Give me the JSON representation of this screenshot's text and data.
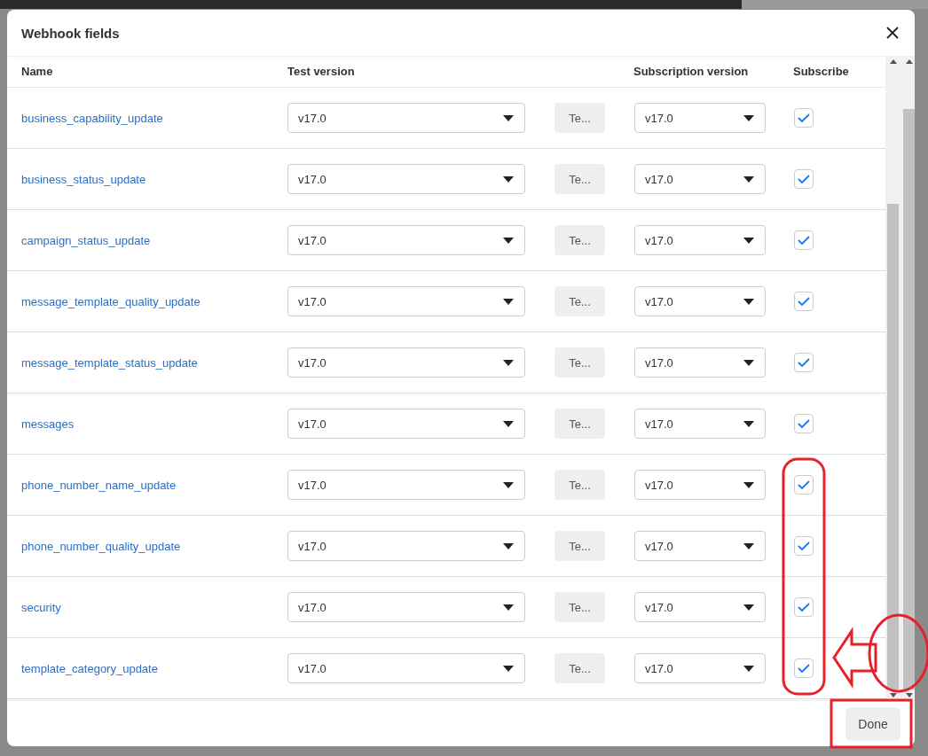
{
  "dialog": {
    "title": "Webhook fields",
    "columns": [
      "Name",
      "Test version",
      "Subscription version",
      "Subscribe"
    ],
    "rows": [
      {
        "name": "business_capability_update",
        "test_version": "v17.0",
        "test_button": "Te...",
        "subscription_version": "v17.0",
        "subscribed": true
      },
      {
        "name": "business_status_update",
        "test_version": "v17.0",
        "test_button": "Te...",
        "subscription_version": "v17.0",
        "subscribed": true
      },
      {
        "name": "campaign_status_update",
        "test_version": "v17.0",
        "test_button": "Te...",
        "subscription_version": "v17.0",
        "subscribed": true
      },
      {
        "name": "message_template_quality_update",
        "test_version": "v17.0",
        "test_button": "Te...",
        "subscription_version": "v17.0",
        "subscribed": true
      },
      {
        "name": "message_template_status_update",
        "test_version": "v17.0",
        "test_button": "Te...",
        "subscription_version": "v17.0",
        "subscribed": true
      },
      {
        "name": "messages",
        "test_version": "v17.0",
        "test_button": "Te...",
        "subscription_version": "v17.0",
        "subscribed": true
      },
      {
        "name": "phone_number_name_update",
        "test_version": "v17.0",
        "test_button": "Te...",
        "subscription_version": "v17.0",
        "subscribed": true
      },
      {
        "name": "phone_number_quality_update",
        "test_version": "v17.0",
        "test_button": "Te...",
        "subscription_version": "v17.0",
        "subscribed": true
      },
      {
        "name": "security",
        "test_version": "v17.0",
        "test_button": "Te...",
        "subscription_version": "v17.0",
        "subscribed": true
      },
      {
        "name": "template_category_update",
        "test_version": "v17.0",
        "test_button": "Te...",
        "subscription_version": "v17.0",
        "subscribed": true
      }
    ],
    "done_button": "Done"
  }
}
